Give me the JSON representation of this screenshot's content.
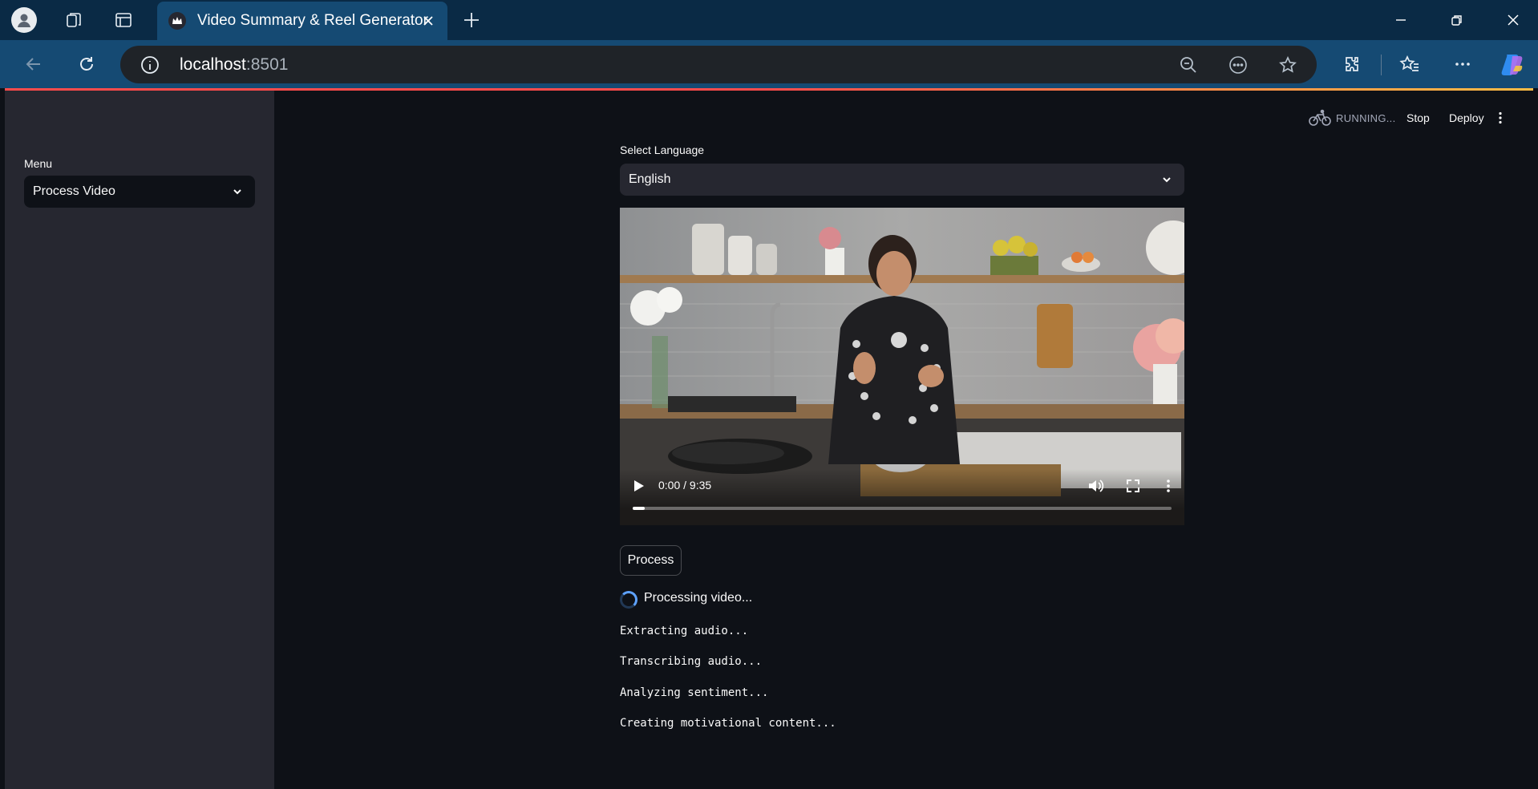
{
  "browser": {
    "tab_title": "Video Summary & Reel Generator",
    "address_host": "localhost",
    "address_port": ":8501"
  },
  "sidebar": {
    "menu_label": "Menu",
    "menu_value": "Process Video"
  },
  "header": {
    "running": "RUNNING...",
    "stop": "Stop",
    "deploy": "Deploy"
  },
  "main": {
    "language_label": "Select Language",
    "language_value": "English",
    "video": {
      "time": "0:00 / 9:35",
      "progress": 0.0
    },
    "process_button": "Process",
    "spinner_text": "Processing video...",
    "log": [
      "Extracting audio...",
      "Transcribing audio...",
      "Analyzing sentiment...",
      "Creating motivational content..."
    ]
  },
  "colors": {
    "app_bg": "#0e1117",
    "sidebar_bg": "#262730",
    "accent": "#ff4b4b",
    "spinner": "#5ea2ff"
  }
}
